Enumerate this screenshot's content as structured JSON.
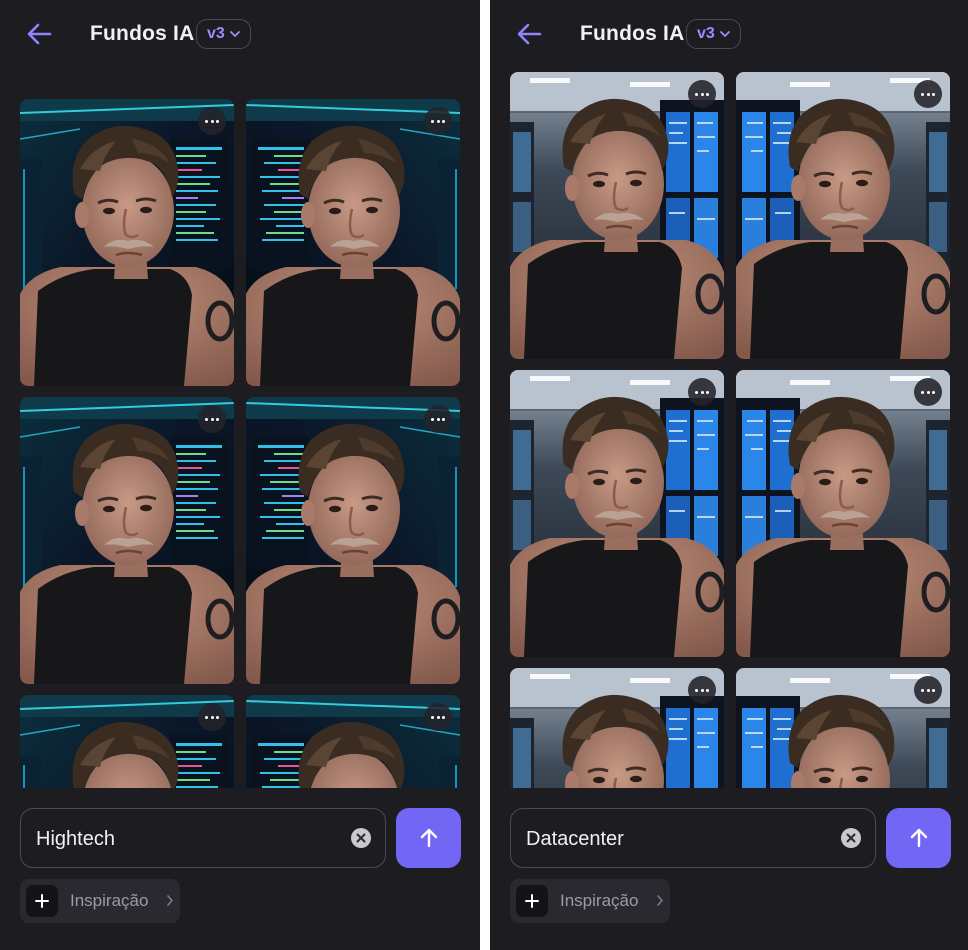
{
  "panels": [
    {
      "title": "Fundos IA",
      "version": "v3",
      "prompt_value": "Hightech",
      "inspiration_label": "Inspiração",
      "accent": "#7267f5",
      "scene": "hightech",
      "icons": [
        "back-arrow-icon",
        "chevron-down-icon",
        "more-icon",
        "clear-icon",
        "send-arrow-icon",
        "plus-icon",
        "chevron-right-icon"
      ]
    },
    {
      "title": "Fundos IA",
      "version": "v3",
      "prompt_value": "Datacenter",
      "inspiration_label": "Inspiração",
      "accent": "#7267f5",
      "scene": "datacenter",
      "icons": [
        "back-arrow-icon",
        "chevron-down-icon",
        "more-icon",
        "clear-icon",
        "send-arrow-icon",
        "plus-icon",
        "chevron-right-icon"
      ]
    }
  ]
}
